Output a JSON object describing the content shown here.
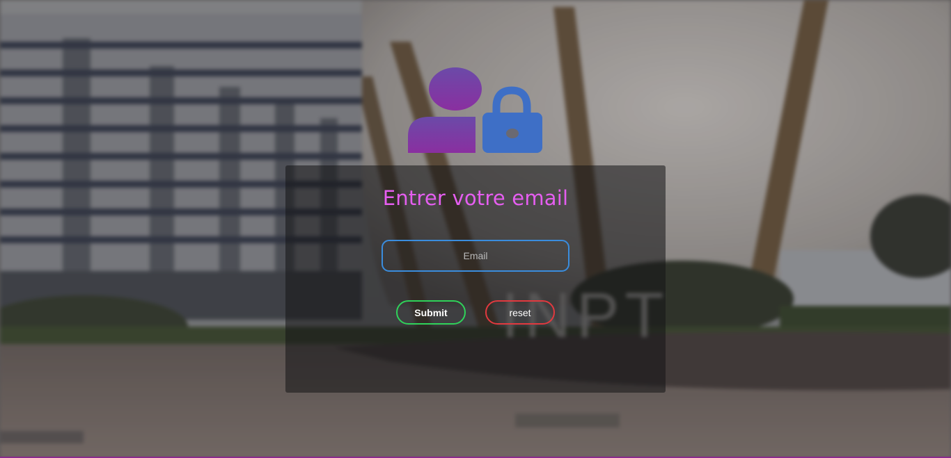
{
  "form": {
    "title": "Entrer votre email",
    "email_placeholder": "Email",
    "email_value": "",
    "submit_label": "Submit",
    "reset_label": "reset"
  },
  "background": {
    "sign_text": "INPT"
  },
  "icons": {
    "hero": "user-lock-icon"
  },
  "colors": {
    "title": "#e55ef0",
    "input_border": "#3a8dde",
    "submit_border": "#2fd35a",
    "reset_border": "#e2393f",
    "user_icon": "#8a3aa8",
    "lock_icon": "#3f6fc8"
  }
}
